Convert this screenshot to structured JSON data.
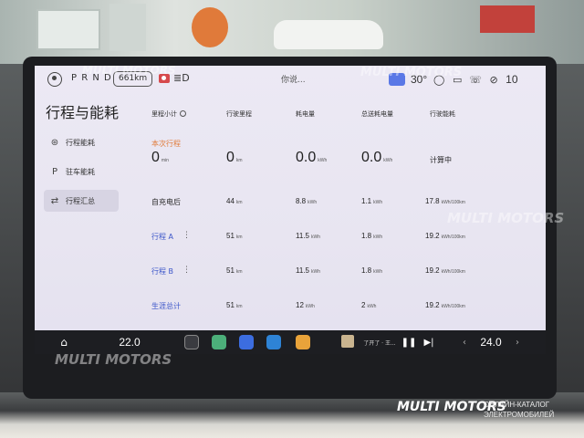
{
  "status_bar": {
    "gear_selector": "P R N D",
    "range": "661km",
    "voice_prompt": "你说...",
    "outside_temp": "30°",
    "battery": "10",
    "icons": [
      "avatar-icon",
      "camera-icon",
      "headlight-icon",
      "ac-icon",
      "message-icon",
      "dashcam-icon",
      "phone-icon",
      "signal-off-icon"
    ]
  },
  "page": {
    "title": "行程与能耗"
  },
  "nav": {
    "items": [
      {
        "label": "行程能耗",
        "icon": "steering-wheel-icon",
        "active": false
      },
      {
        "label": "驻车能耗",
        "icon": "parking-icon",
        "active": false
      },
      {
        "label": "行程汇总",
        "icon": "swap-icon",
        "active": true
      }
    ]
  },
  "table": {
    "headers": [
      "里程小计",
      "行驶里程",
      "耗电量",
      "总送耗电量",
      "行驶能耗"
    ],
    "rows": [
      {
        "label": "本次行程",
        "style": "orange",
        "values": [
          {
            "v": "0",
            "u": "min"
          },
          {
            "v": "0",
            "u": "km"
          },
          {
            "v": "0.0",
            "u": "kWh"
          },
          {
            "v": "0.0",
            "u": "kWh"
          },
          {
            "v": "计算中",
            "u": ""
          }
        ]
      },
      {
        "label": "自充电后",
        "style": "dark",
        "values": [
          {
            "v": "44",
            "u": "km"
          },
          {
            "v": "8.8",
            "u": "kWh"
          },
          {
            "v": "1.1",
            "u": "kWh"
          },
          {
            "v": "17.8",
            "u": "kWh/100km"
          }
        ]
      },
      {
        "label": "行程 A",
        "style": "blue",
        "values": [
          {
            "v": "51",
            "u": "km"
          },
          {
            "v": "11.5",
            "u": "kWh"
          },
          {
            "v": "1.8",
            "u": "kWh"
          },
          {
            "v": "19.2",
            "u": "kWh/100km"
          }
        ]
      },
      {
        "label": "行程 B",
        "style": "blue",
        "values": [
          {
            "v": "51",
            "u": "km"
          },
          {
            "v": "11.5",
            "u": "kWh"
          },
          {
            "v": "1.8",
            "u": "kWh"
          },
          {
            "v": "19.2",
            "u": "kWh/100km"
          }
        ]
      },
      {
        "label": "生涯总计",
        "style": "blue",
        "values": [
          {
            "v": "51",
            "u": "km"
          },
          {
            "v": "12",
            "u": "kWh"
          },
          {
            "v": "2",
            "u": "kWh"
          },
          {
            "v": "19.2",
            "u": "kWh/100km"
          }
        ]
      }
    ]
  },
  "dock": {
    "left_temp": "22.0",
    "right_temp": "24.0",
    "media_title": "了开了 · 王...",
    "apps": [
      "home-icon",
      "settings-app-icon",
      "maps-app-icon",
      "video-app-icon",
      "notes-app-icon",
      "apps-grid-icon"
    ]
  },
  "watermark": {
    "brand": "MULTI MOTORS",
    "footer_line1": "ОНЛАЙН-КАТАЛОГ",
    "footer_line2": "ЭЛЕКТРОМОБИЛЕЙ"
  },
  "colors": {
    "accent_orange": "#e07b3a",
    "accent_blue": "#3c56c9",
    "active_nav": "#d7d4e3",
    "screen_bg": "#ece9f4"
  }
}
